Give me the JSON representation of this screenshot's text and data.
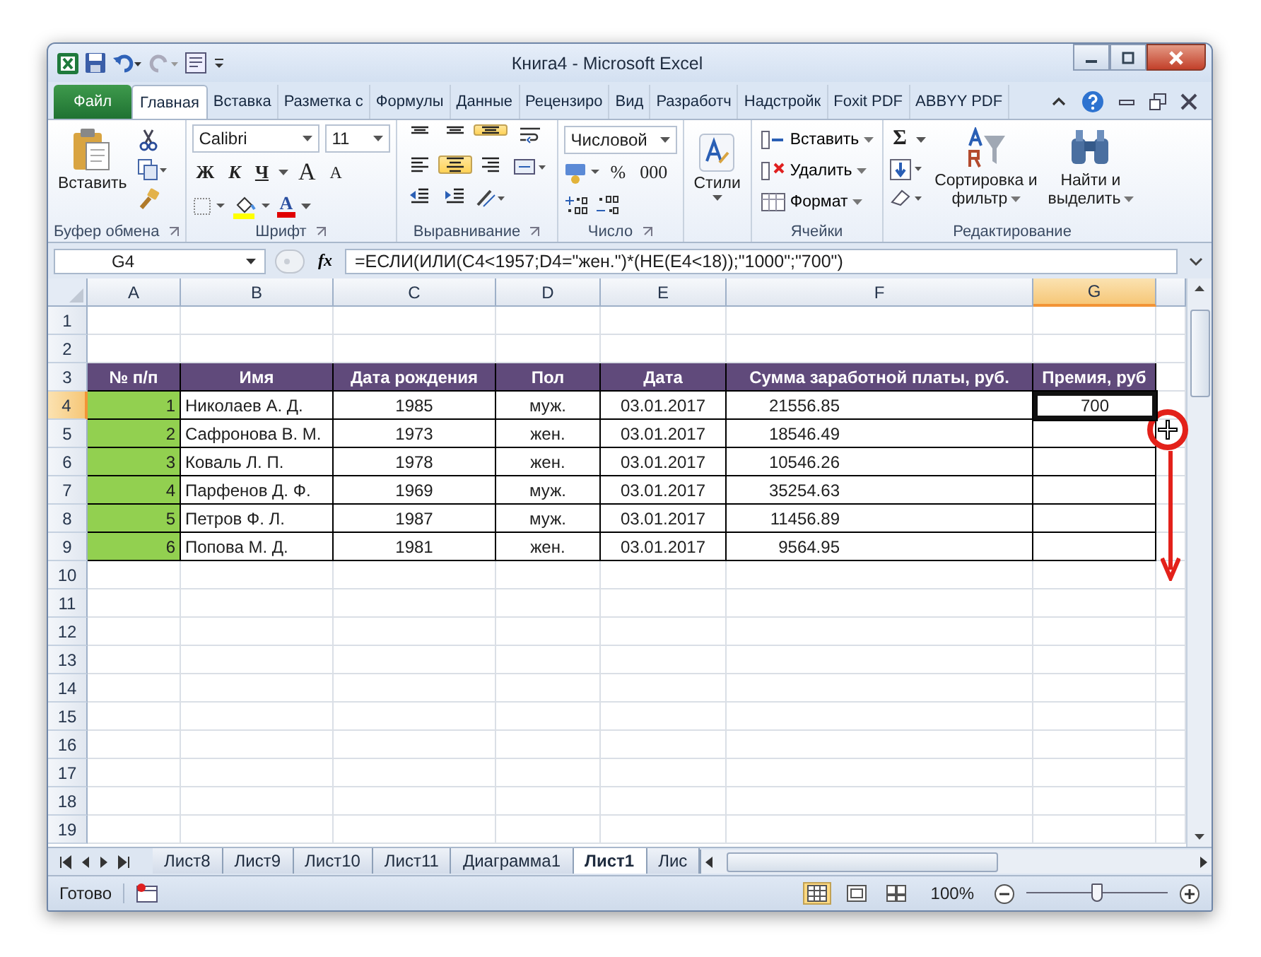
{
  "window": {
    "title": "Книга4  -  Microsoft Excel"
  },
  "ribbon_tabs": [
    {
      "label": "Файл",
      "kind": "file",
      "selected": false
    },
    {
      "label": "Главная",
      "kind": "tab",
      "selected": true
    },
    {
      "label": "Вставка",
      "kind": "tab",
      "selected": false
    },
    {
      "label": "Разметка с",
      "kind": "tab",
      "selected": false
    },
    {
      "label": "Формулы",
      "kind": "tab",
      "selected": false
    },
    {
      "label": "Данные",
      "kind": "tab",
      "selected": false
    },
    {
      "label": "Рецензиро",
      "kind": "tab",
      "selected": false
    },
    {
      "label": "Вид",
      "kind": "tab",
      "selected": false
    },
    {
      "label": "Разработч",
      "kind": "tab",
      "selected": false
    },
    {
      "label": "Надстройк",
      "kind": "tab",
      "selected": false
    },
    {
      "label": "Foxit PDF",
      "kind": "tab",
      "selected": false
    },
    {
      "label": "ABBYY PDF",
      "kind": "tab",
      "selected": false
    }
  ],
  "ribbon": {
    "clipboard": {
      "paste": "Вставить",
      "label": "Буфер обмена"
    },
    "font": {
      "name": "Calibri",
      "size": "11",
      "bold": "Ж",
      "italic": "К",
      "underline": "Ч",
      "grow": "A",
      "shrink": "A",
      "font_color": "A",
      "label": "Шрифт"
    },
    "alignment": {
      "buttons": [
        {
          "kind": "top",
          "selected": false
        },
        {
          "kind": "middle",
          "selected": false
        },
        {
          "kind": "bottom",
          "selected": true
        },
        {
          "kind": "wrap",
          "selected": false
        },
        {
          "kind": "left",
          "selected": false
        },
        {
          "kind": "center",
          "selected": true
        },
        {
          "kind": "right",
          "selected": false
        },
        {
          "kind": "merge",
          "selected": false
        },
        {
          "kind": "outdent",
          "selected": false
        },
        {
          "kind": "indent",
          "selected": false
        },
        {
          "kind": "orientation",
          "selected": false
        }
      ],
      "label": "Выравнивание"
    },
    "number": {
      "format": "Числовой",
      "percent": "%",
      "thousands": "000",
      "label": "Число"
    },
    "styles": {
      "button": "Стили"
    },
    "cells": {
      "buttons": [
        {
          "kind": "insert",
          "label": "Вставить"
        },
        {
          "kind": "delete",
          "label": "Удалить"
        },
        {
          "kind": "format",
          "label": "Формат"
        }
      ],
      "label": "Ячейки"
    },
    "editing": {
      "sum": "Σ",
      "sort": "Сортировка и фильтр",
      "find": "Найти и выделить",
      "label": "Редактирование"
    }
  },
  "formula_bar": {
    "name_box": "G4",
    "function_button": "fx",
    "formula": "=ЕСЛИ(ИЛИ(C4<1957;D4=\"жен.\")*(НЕ(E4<18));\"1000\";\"700\")"
  },
  "columns": [
    {
      "label": "A",
      "selected": false
    },
    {
      "label": "B",
      "selected": false
    },
    {
      "label": "C",
      "selected": false
    },
    {
      "label": "D",
      "selected": false
    },
    {
      "label": "E",
      "selected": false
    },
    {
      "label": "F",
      "selected": false
    },
    {
      "label": "G",
      "selected": true
    }
  ],
  "rows": [
    {
      "number": "1",
      "kind": "empty",
      "selected": false
    },
    {
      "number": "2",
      "kind": "empty",
      "selected": false
    },
    {
      "number": "3",
      "kind": "header",
      "selected": false,
      "cells": [
        {
          "text": "№ п/п"
        },
        {
          "text": "Имя"
        },
        {
          "text": "Дата рождения"
        },
        {
          "text": "Пол"
        },
        {
          "text": "Дата"
        },
        {
          "text": "Сумма заработной платы, руб."
        },
        {
          "text": "Премия, руб"
        }
      ]
    },
    {
      "number": "4",
      "kind": "data",
      "selected": true,
      "cells": [
        {
          "text": "1",
          "selected": false
        },
        {
          "text": "Николаев А. Д.",
          "selected": false
        },
        {
          "text": "1985",
          "selected": false
        },
        {
          "text": "муж.",
          "selected": false
        },
        {
          "text": "03.01.2017",
          "selected": false
        },
        {
          "text": "21556.85",
          "selected": false
        },
        {
          "text": "700",
          "selected": true
        }
      ]
    },
    {
      "number": "5",
      "kind": "data",
      "selected": false,
      "cells": [
        {
          "text": "2",
          "selected": false
        },
        {
          "text": "Сафронова В. М.",
          "selected": false
        },
        {
          "text": "1973",
          "selected": false
        },
        {
          "text": "жен.",
          "selected": false
        },
        {
          "text": "03.01.2017",
          "selected": false
        },
        {
          "text": "18546.49",
          "selected": false
        },
        {
          "text": "",
          "selected": false
        }
      ]
    },
    {
      "number": "6",
      "kind": "data",
      "selected": false,
      "cells": [
        {
          "text": "3",
          "selected": false
        },
        {
          "text": "Коваль Л. П.",
          "selected": false
        },
        {
          "text": "1978",
          "selected": false
        },
        {
          "text": "жен.",
          "selected": false
        },
        {
          "text": "03.01.2017",
          "selected": false
        },
        {
          "text": "10546.26",
          "selected": false
        },
        {
          "text": "",
          "selected": false
        }
      ]
    },
    {
      "number": "7",
      "kind": "data",
      "selected": false,
      "cells": [
        {
          "text": "4",
          "selected": false
        },
        {
          "text": "Парфенов Д. Ф.",
          "selected": false
        },
        {
          "text": "1969",
          "selected": false
        },
        {
          "text": "муж.",
          "selected": false
        },
        {
          "text": "03.01.2017",
          "selected": false
        },
        {
          "text": "35254.63",
          "selected": false
        },
        {
          "text": "",
          "selected": false
        }
      ]
    },
    {
      "number": "8",
      "kind": "data",
      "selected": false,
      "cells": [
        {
          "text": "5",
          "selected": false
        },
        {
          "text": "Петров Ф. Л.",
          "selected": false
        },
        {
          "text": "1987",
          "selected": false
        },
        {
          "text": "муж.",
          "selected": false
        },
        {
          "text": "03.01.2017",
          "selected": false
        },
        {
          "text": "11456.89",
          "selected": false
        },
        {
          "text": "",
          "selected": false
        }
      ]
    },
    {
      "number": "9",
      "kind": "data",
      "selected": false,
      "cells": [
        {
          "text": "6",
          "selected": false
        },
        {
          "text": "Попова М. Д.",
          "selected": false
        },
        {
          "text": "1981",
          "selected": false
        },
        {
          "text": "жен.",
          "selected": false
        },
        {
          "text": "03.01.2017",
          "selected": false
        },
        {
          "text": "9564.95",
          "selected": false
        },
        {
          "text": "",
          "selected": false
        }
      ]
    },
    {
      "number": "10",
      "kind": "empty",
      "selected": false
    },
    {
      "number": "11",
      "kind": "empty",
      "selected": false
    },
    {
      "number": "12",
      "kind": "empty",
      "selected": false
    },
    {
      "number": "13",
      "kind": "empty",
      "selected": false
    },
    {
      "number": "14",
      "kind": "empty",
      "selected": false
    },
    {
      "number": "15",
      "kind": "empty",
      "selected": false
    },
    {
      "number": "16",
      "kind": "empty",
      "selected": false
    },
    {
      "number": "17",
      "kind": "empty",
      "selected": false
    },
    {
      "number": "18",
      "kind": "empty",
      "selected": false
    },
    {
      "number": "19",
      "kind": "empty",
      "selected": false
    }
  ],
  "sheet_tabs": [
    {
      "label": "Лист8",
      "selected": false
    },
    {
      "label": "Лист9",
      "selected": false
    },
    {
      "label": "Лист10",
      "selected": false
    },
    {
      "label": "Лист11",
      "selected": false
    },
    {
      "label": "Диаграмма1",
      "selected": false
    },
    {
      "label": "Лист1",
      "selected": true
    },
    {
      "label": "Лис",
      "selected": false
    }
  ],
  "status_bar": {
    "status": "Готово",
    "views": [
      {
        "kind": "normal",
        "selected": true
      },
      {
        "kind": "layout",
        "selected": false
      },
      {
        "kind": "pagebreak",
        "selected": false
      }
    ],
    "zoom": "100%",
    "zoom_slider": {
      "level": 0.5
    }
  }
}
